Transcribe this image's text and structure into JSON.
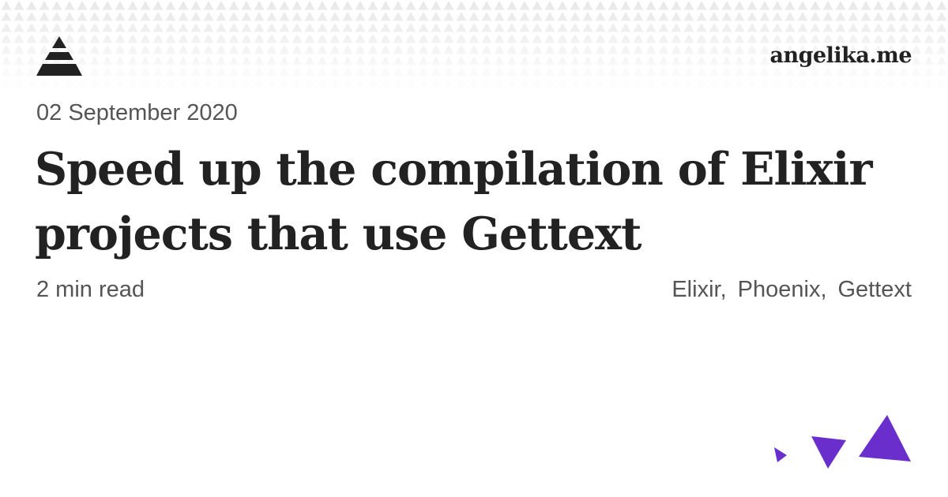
{
  "header": {
    "logo_icon": "pyramid-logo-icon",
    "site_name": "angelika.me"
  },
  "post": {
    "date": "02 September 2020",
    "title": "Speed up the compilation of Elixir projects that use Gettext",
    "read_time": "2 min read",
    "tags": [
      "Elixir,",
      "Phoenix,",
      "Gettext"
    ]
  },
  "colors": {
    "accent": "#6a2ecc",
    "text": "#222222",
    "muted": "#555555",
    "pattern": "#e6e6e6"
  },
  "decor": {
    "icon": "purple-triangles-icon"
  }
}
